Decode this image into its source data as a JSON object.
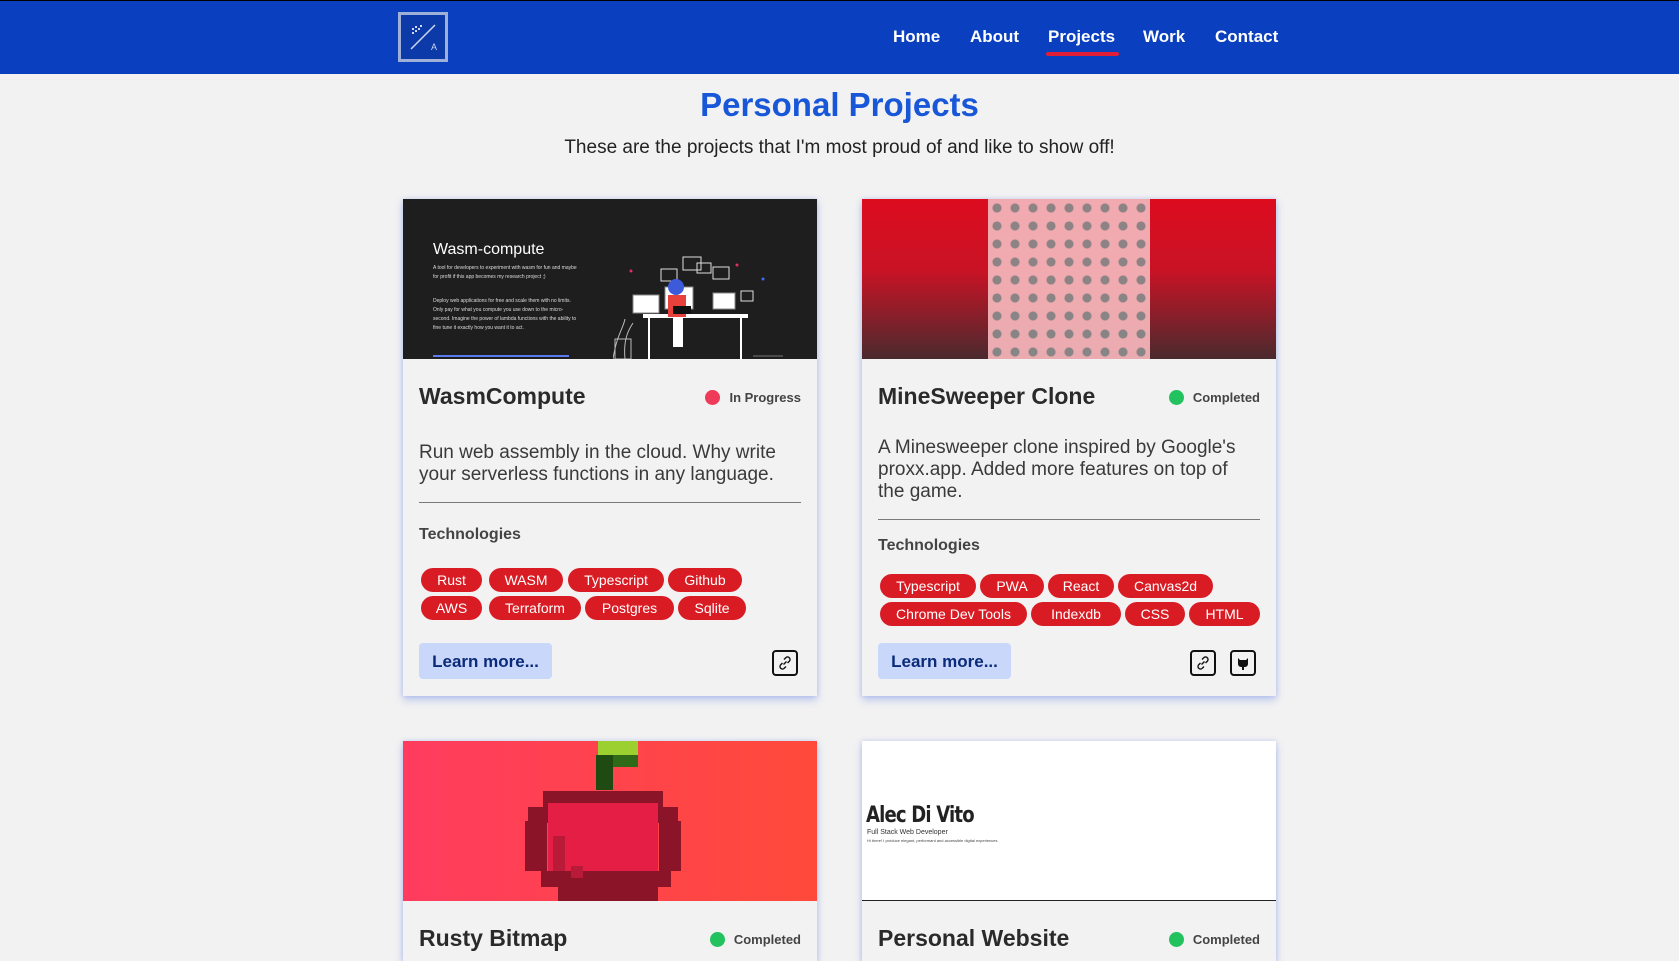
{
  "nav": {
    "links": [
      {
        "label": "Home"
      },
      {
        "label": "About"
      },
      {
        "label": "Projects"
      },
      {
        "label": "Work"
      },
      {
        "label": "Contact"
      }
    ],
    "active": "Projects"
  },
  "page": {
    "title": "Personal Projects",
    "subtitle": "These are the projects that I'm most proud of and like to show off!"
  },
  "projects": [
    {
      "name": "WasmCompute",
      "status": "In Progress",
      "status_color": "#ee3b5a",
      "description": "Run web assembly in the cloud. Why write your serverless functions in any language.",
      "technologies_label": "Technologies",
      "technologies": [
        "Rust",
        "WASM",
        "Typescript",
        "Github",
        "AWS",
        "Terraform",
        "Postgres",
        "Sqlite"
      ],
      "learn_more": "Learn more...",
      "links": [
        "link-icon"
      ],
      "preview": {
        "heading": "Wasm-compute",
        "text1": "A tool for developers to experiment with wasm for fun and maybe for profit if this app becomes my research project ;)",
        "text2": "Deploy web applications for free and scale them with no limits. Only pay for what you compute you use down to the micro-second. Imagine the power of lambda functions with the ability to fine tune it exactly how you want it to act."
      }
    },
    {
      "name": "MineSweeper Clone",
      "status": "Completed",
      "status_color": "#22c35e",
      "description": "A Minesweeper clone inspired by Google's proxx.app. Added more features on top of the game.",
      "technologies_label": "Technologies",
      "technologies": [
        "Typescript",
        "PWA",
        "React",
        "Canvas2d",
        "Chrome Dev Tools",
        "Indexdb",
        "CSS",
        "HTML"
      ],
      "learn_more": "Learn more...",
      "links": [
        "link-icon",
        "github-icon"
      ]
    },
    {
      "name": "Rusty Bitmap",
      "status": "Completed",
      "status_color": "#22c35e"
    },
    {
      "name": "Personal Website",
      "status": "Completed",
      "status_color": "#22c35e",
      "preview": {
        "name": "Alec Di Vito",
        "role": "Full Stack Web Developer",
        "tagline": "Hi there! I produce elegant, performant and accessible digital experiences"
      }
    }
  ]
}
